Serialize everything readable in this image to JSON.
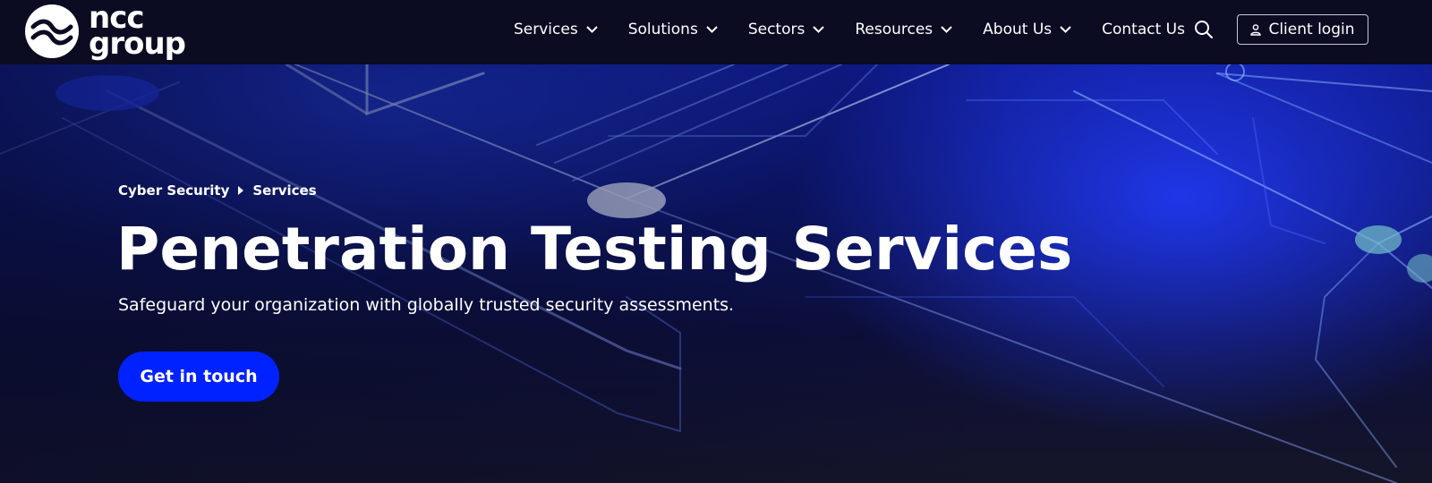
{
  "brand": {
    "logo_text_line1": "ncc",
    "logo_text_line2": "group"
  },
  "nav": {
    "items": [
      {
        "label": "Services",
        "icon": "chevron-down-icon"
      },
      {
        "label": "Solutions",
        "icon": "chevron-down-icon"
      },
      {
        "label": "Sectors",
        "icon": "chevron-down-icon"
      },
      {
        "label": "Resources",
        "icon": "chevron-down-icon"
      },
      {
        "label": "About Us",
        "icon": "chevron-down-icon"
      },
      {
        "label": "Contact Us"
      }
    ],
    "search_icon": "search-icon",
    "login_label": "Client login",
    "login_icon": "user-icon"
  },
  "hero": {
    "breadcrumb": [
      "Cyber Security",
      "Services"
    ],
    "breadcrumb_separator_icon": "caret-right-icon",
    "title": "Penetration Testing Services",
    "subtitle": "Safeguard your organization with globally trusted security assessments.",
    "cta_label": "Get in touch"
  },
  "colors": {
    "nav_background": "#0b0b22",
    "cta_background": "#0022ff",
    "hero_accent": "#233cff",
    "text": "#ffffff"
  }
}
